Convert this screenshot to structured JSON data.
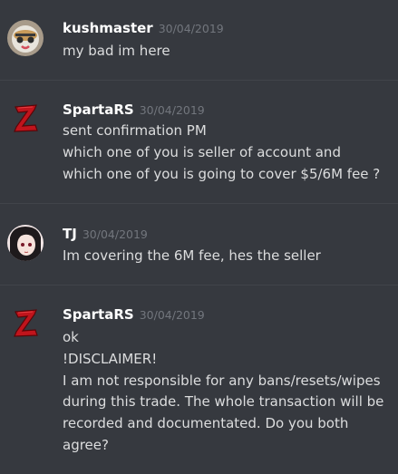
{
  "messages": [
    {
      "author": "kushmaster",
      "timestamp": "30/04/2019",
      "avatar_icon": "cat-avatar-icon",
      "lines": [
        "my bad im here"
      ]
    },
    {
      "author": "SpartaRS",
      "timestamp": "30/04/2019",
      "avatar_icon": "red-z-logo-icon",
      "lines": [
        "sent confirmation PM",
        "which one of you is seller of account and",
        "which one of you is going to cover $5/6M fee ?"
      ]
    },
    {
      "author": "TJ",
      "timestamp": "30/04/2019",
      "avatar_icon": "anime-avatar-icon",
      "lines": [
        "Im covering the 6M fee, hes the seller"
      ]
    },
    {
      "author": "SpartaRS",
      "timestamp": "30/04/2019",
      "avatar_icon": "red-z-logo-icon",
      "lines": [
        "ok",
        "!DISCLAIMER!",
        "I am not responsible for any bans/resets/wipes",
        "during this trade. The whole transaction will be",
        "recorded and documentated. Do you both",
        "agree?"
      ]
    }
  ],
  "colors": {
    "background": "#36393f",
    "author": "#ffffff",
    "timestamp": "#72767d",
    "text": "#dcddde",
    "divider": "#41444a"
  }
}
